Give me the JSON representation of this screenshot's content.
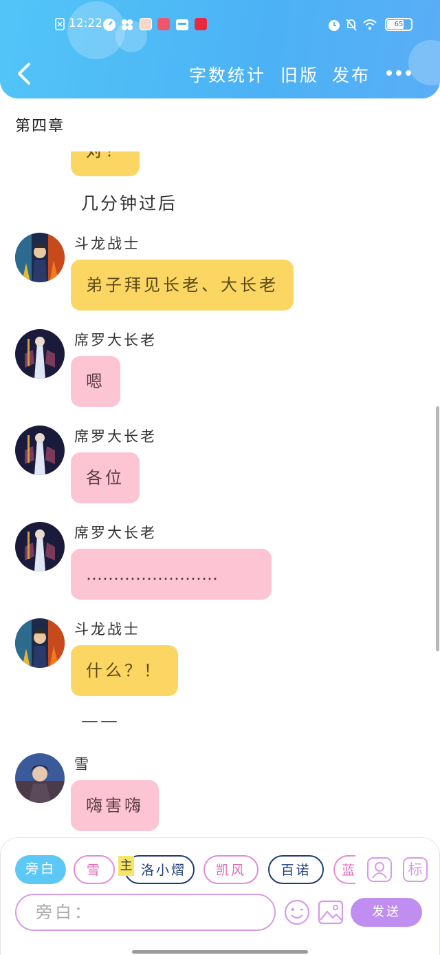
{
  "status_bar": {
    "time": "12:22",
    "battery": "65"
  },
  "nav": {
    "word_count": "字数统计",
    "old_version": "旧版",
    "publish": "发布"
  },
  "chapter_title": "第四章",
  "feed": {
    "partial_message": "对！",
    "narration_1": "几分钟过后",
    "messages": [
      {
        "speaker": "斗龙战士",
        "text": "弟子拜见长老、大长老",
        "color": "yellow"
      },
      {
        "speaker": "席罗大长老",
        "text": "嗯",
        "color": "pink"
      },
      {
        "speaker": "席罗大长老",
        "text": "各位",
        "color": "pink"
      },
      {
        "speaker": "席罗大长老",
        "text": "……………………",
        "color": "pink"
      },
      {
        "speaker": "斗龙战士",
        "text": "什么？！",
        "color": "yellow"
      }
    ],
    "narration_2": "——",
    "last_message": {
      "speaker": "雪",
      "text": "嗨害嗨",
      "color": "pink"
    }
  },
  "composer": {
    "characters": [
      {
        "label": "旁白",
        "selected": true
      },
      {
        "label": "雪"
      },
      {
        "label": "洛小熠",
        "badge": "主"
      },
      {
        "label": "凯风"
      },
      {
        "label": "百诺"
      },
      {
        "label": "蓝"
      }
    ],
    "tag_button": "标",
    "input_placeholder": "旁白：",
    "send_label": "发送"
  },
  "colors": {
    "header": "#4cb2f5",
    "yellow_bubble": "#fcd662",
    "pink_bubble": "#fdc5d3",
    "send": "#bf8ef0",
    "chip_selected": "#5bc8f5"
  }
}
